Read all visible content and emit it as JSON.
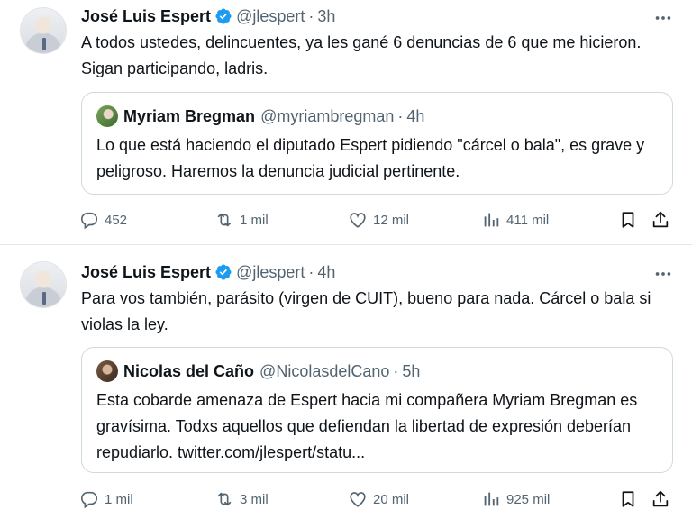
{
  "tweets": [
    {
      "author": {
        "name": "José Luis Espert",
        "handle": "@jlespert",
        "time": "3h"
      },
      "text": "A todos ustedes, delincuentes, ya les gané 6 denuncias de 6 que me hicieron. Sigan participando, ladris.",
      "quote": {
        "name": "Myriam Bregman",
        "handle": "@myriambregman",
        "time": "4h",
        "text": "Lo que está haciendo el diputado Espert pidiendo \"cárcel o bala\", es grave y peligroso. Haremos la denuncia judicial pertinente."
      },
      "stats": {
        "replies": "452",
        "retweets": "1 mil",
        "likes": "12 mil",
        "views": "411 mil"
      }
    },
    {
      "author": {
        "name": "José Luis Espert",
        "handle": "@jlespert",
        "time": "4h"
      },
      "text": "Para vos también, parásito (virgen de CUIT), bueno para nada. Cárcel o bala si violas la ley.",
      "quote": {
        "name": "Nicolas del Caño",
        "handle": "@NicolasdelCano",
        "time": "5h",
        "text": "Esta cobarde amenaza de Espert hacia mi compañera Myriam Bregman es gravísima. Todxs aquellos que defiendan la libertad de expresión deberían repudiarlo. twitter.com/jlespert/statu..."
      },
      "stats": {
        "replies": "1 mil",
        "retweets": "3 mil",
        "likes": "20 mil",
        "views": "925 mil"
      }
    }
  ],
  "separator": "·",
  "colors": {
    "text": "#0f1419",
    "muted": "#536471",
    "verified": "#1d9bf0",
    "border": "#cfd9de"
  },
  "icons": [
    "verified-badge-icon",
    "more-options-icon",
    "reply-icon",
    "retweet-icon",
    "like-icon",
    "views-icon",
    "bookmark-icon",
    "share-icon"
  ]
}
